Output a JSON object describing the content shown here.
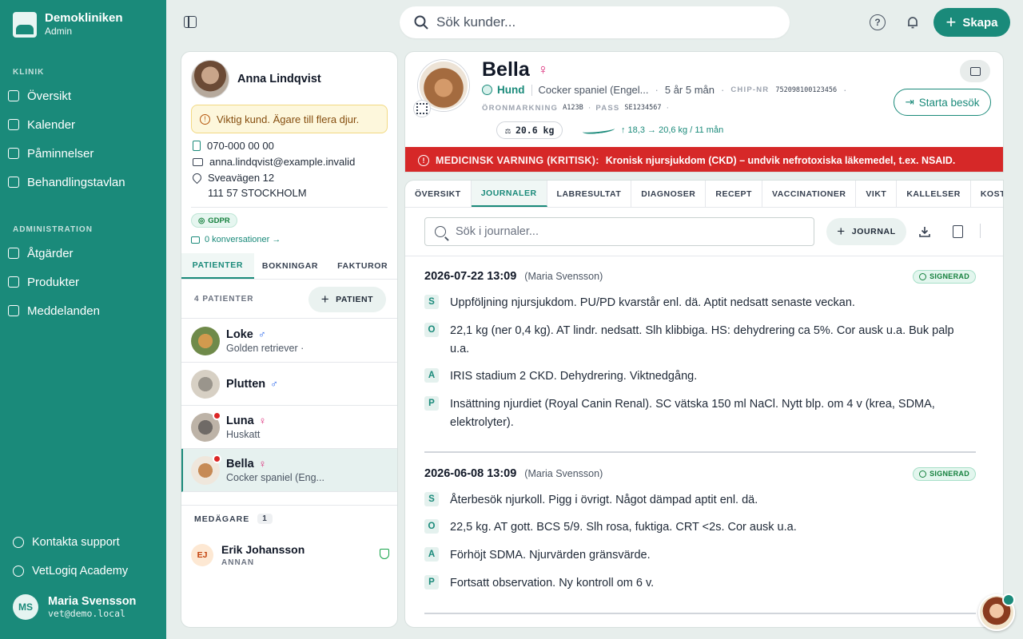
{
  "sidebar": {
    "brand": {
      "name": "Demokliniken",
      "role": "Admin"
    },
    "sections": {
      "klinik": "KLINIK",
      "admin": "ADMINISTRATION"
    },
    "klinik_items": [
      {
        "label": "Översikt",
        "icon": "grid-icon"
      },
      {
        "label": "Kalender",
        "icon": "calendar-icon"
      },
      {
        "label": "Påminnelser",
        "icon": "reminder-icon"
      },
      {
        "label": "Behandlingstavlan",
        "icon": "board-icon"
      }
    ],
    "admin_items": [
      {
        "label": "Åtgärder",
        "icon": "clipboard-icon"
      },
      {
        "label": "Produkter",
        "icon": "box-icon"
      },
      {
        "label": "Meddelanden",
        "icon": "message-icon"
      }
    ],
    "support": "Kontakta support",
    "academy": "VetLogiq Academy",
    "user": {
      "initials": "MS",
      "name": "Maria Svensson",
      "email": "vet@demo.local"
    }
  },
  "topbar": {
    "search_placeholder": "Sök kunder...",
    "create_label": "Skapa"
  },
  "owner": {
    "name": "Anna Lindqvist",
    "vip_note": "Viktig kund. Ägare till flera djur.",
    "phone": "070-000 00 00",
    "email": "anna.lindqvist@example.invalid",
    "street": "Sveavägen 12",
    "city": "111 57 STOCKHOLM",
    "gdpr": "GDPR",
    "conversations": "0 konversationer →",
    "tabs": [
      "PATIENTER",
      "BOKNINGAR",
      "FAKTUROR"
    ],
    "patients_count": "4 PATIENTER",
    "add_patient": "PATIENT",
    "patients": [
      {
        "name": "Loke",
        "sex": "♂",
        "breed": "Golden retriever ·"
      },
      {
        "name": "Plutten",
        "sex": "♂",
        "breed": ""
      },
      {
        "name": "Luna",
        "sex": "♀",
        "breed": "Huskatt"
      },
      {
        "name": "Bella",
        "sex": "♀",
        "breed": "Cocker spaniel (Eng..."
      }
    ],
    "coowners_label": "MEDÄGARE",
    "coowners_count": "1",
    "coowner": {
      "initials": "EJ",
      "name": "Erik Johansson",
      "role": "ANNAN"
    }
  },
  "patient": {
    "name": "Bella",
    "sex": "♀",
    "species": "Hund",
    "breed": "Cocker spaniel (Engel...",
    "age": "5 år 5 mån",
    "chip_label": "CHIP-NR",
    "chip": "752098100123456",
    "ear_label": "ÖRONMARKNING",
    "ear": "A123B",
    "pass_label": "PASS",
    "pass": "SE1234567",
    "weight": "20.6 kg",
    "weight_trend": "↑ 18,3 → 20,6 kg / 11 mån",
    "visit_button": "Starta besök",
    "alert_label": "MEDICINSK VARNING (KRITISK):",
    "alert_text": "Kronisk njursjukdom (CKD) – undvik nefrotoxiska läkemedel, t.ex. NSAID."
  },
  "journal": {
    "tabs": [
      "ÖVERSIKT",
      "JOURNALER",
      "LABRESULTAT",
      "DIAGNOSER",
      "RECEPT",
      "VACCINATIONER",
      "VIKT",
      "KALLELSER",
      "KOSTNADS"
    ],
    "search_placeholder": "Sök i journaler...",
    "add_label": "JOURNAL",
    "signed_label": "SIGNERAD",
    "entries": [
      {
        "date": "2026-07-22 13:09",
        "author": "(Maria Svensson)",
        "S": "Uppföljning njursjukdom. PU/PD kvarstår enl. dä. Aptit nedsatt senaste veckan.",
        "O": "22,1 kg (ner 0,4 kg). AT lindr. nedsatt. Slh klibbiga. HS: dehydrering ca 5%. Cor ausk u.a. Buk palp u.a.",
        "A": "IRIS stadium 2 CKD. Dehydrering. Viktnedgång.",
        "P": "Insättning njurdiet (Royal Canin Renal). SC vätska 150 ml NaCl. Nytt blp. om 4 v (krea, SDMA, elektrolyter)."
      },
      {
        "date": "2026-06-08 13:09",
        "author": "(Maria Svensson)",
        "S": "Återbesök njurkoll. Pigg i övrigt. Något dämpad aptit enl. dä.",
        "O": "22,5 kg. AT gott. BCS 5/9. Slh rosa, fuktiga. CRT <2s. Cor ausk u.a.",
        "A": "Förhöjt SDMA. Njurvärden gränsvärde.",
        "P": "Fortsatt observation. Ny kontroll om 6 v."
      }
    ]
  },
  "colors": {
    "brand": "#1a8a7a",
    "alert": "#d62828",
    "female": "#db2777",
    "male": "#2563eb"
  }
}
